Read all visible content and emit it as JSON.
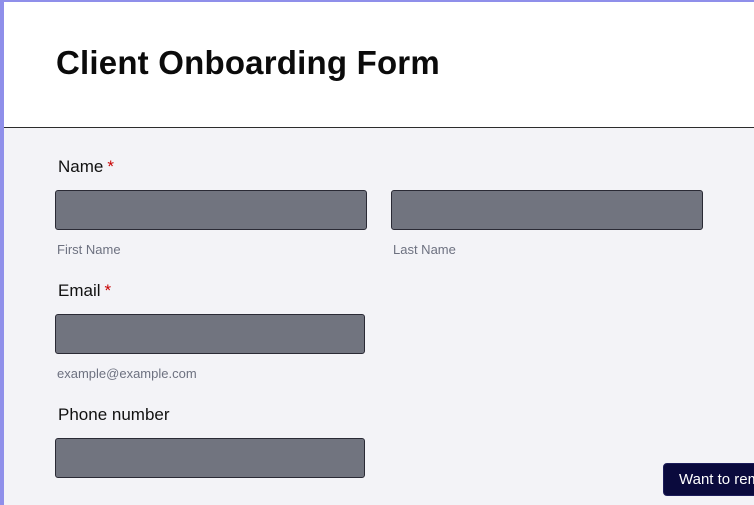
{
  "form": {
    "title": "Client Onboarding Form"
  },
  "fields": {
    "name": {
      "label": "Name",
      "required_mark": "*",
      "first_value": "",
      "last_value": "",
      "first_sublabel": "First Name",
      "last_sublabel": "Last Name"
    },
    "email": {
      "label": "Email",
      "required_mark": "*",
      "value": "",
      "sublabel": "example@example.com"
    },
    "phone": {
      "label": "Phone number",
      "value": ""
    }
  },
  "toast": {
    "label": "Want to rem"
  },
  "colors": {
    "accent_border": "#8f8fea",
    "input_fill": "#71747f",
    "required": "#c80000",
    "toast_bg": "#0a0a3d"
  }
}
